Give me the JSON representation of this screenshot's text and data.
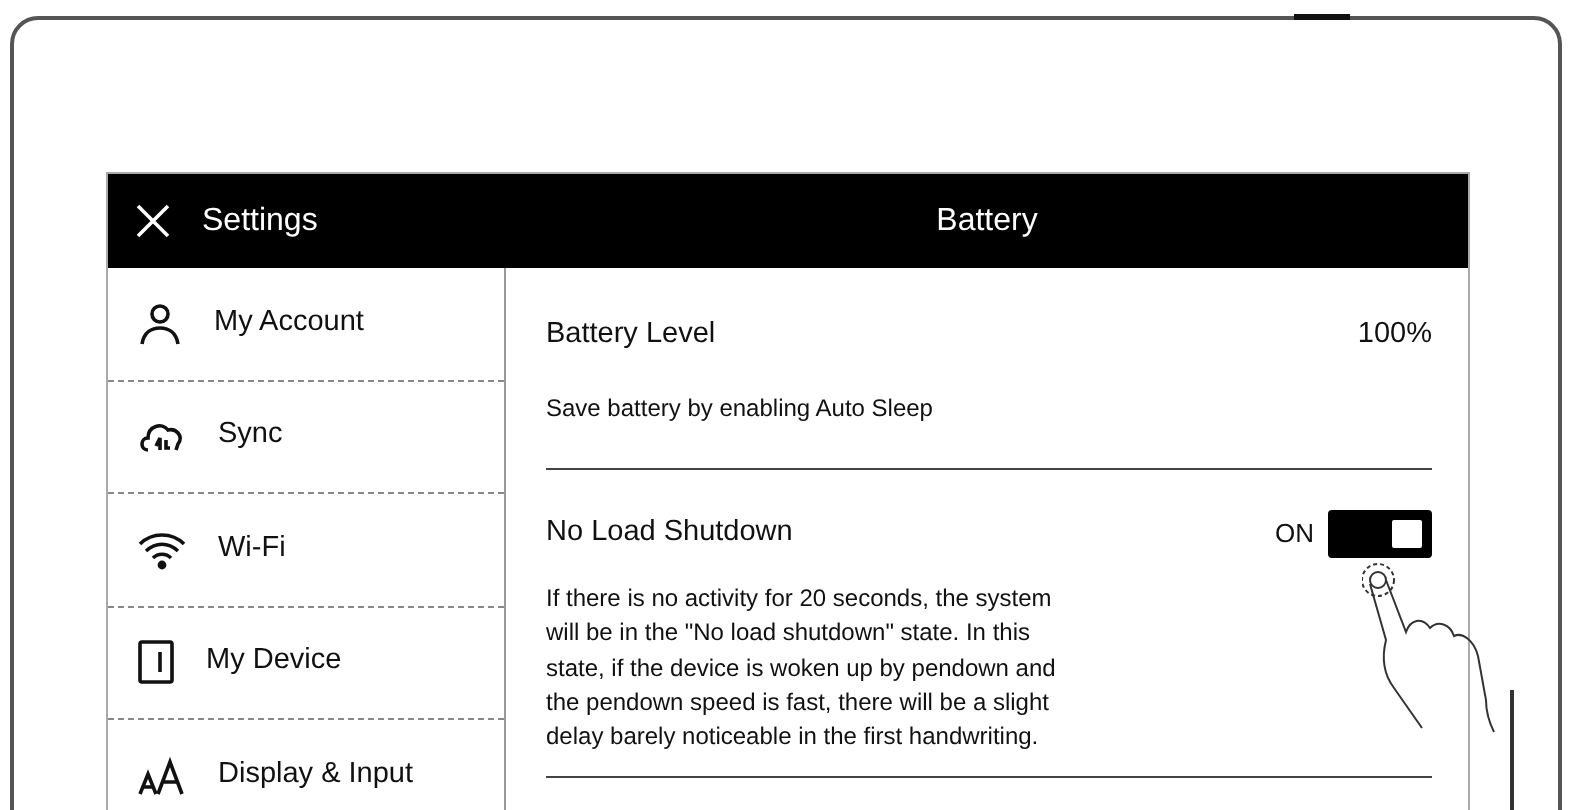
{
  "header": {
    "title": "Settings",
    "page_title": "Battery"
  },
  "sidebar": {
    "items": [
      {
        "label": "My Account"
      },
      {
        "label": "Sync"
      },
      {
        "label": "Wi-Fi"
      },
      {
        "label": "My Device"
      },
      {
        "label": "Display & Input"
      }
    ]
  },
  "battery": {
    "label": "Battery Level",
    "value": "100%",
    "hint": "Save battery by enabling Auto Sleep"
  },
  "no_load_shutdown": {
    "label": "No Load Shutdown",
    "state_label": "ON",
    "on": true,
    "description": "If there is no activity for 20 seconds, the system will be in the \"No load shutdown\" state. In this state, if the device is woken up by pendown and the pendown speed is fast, there will be a slight delay barely noticeable in the first handwriting."
  }
}
